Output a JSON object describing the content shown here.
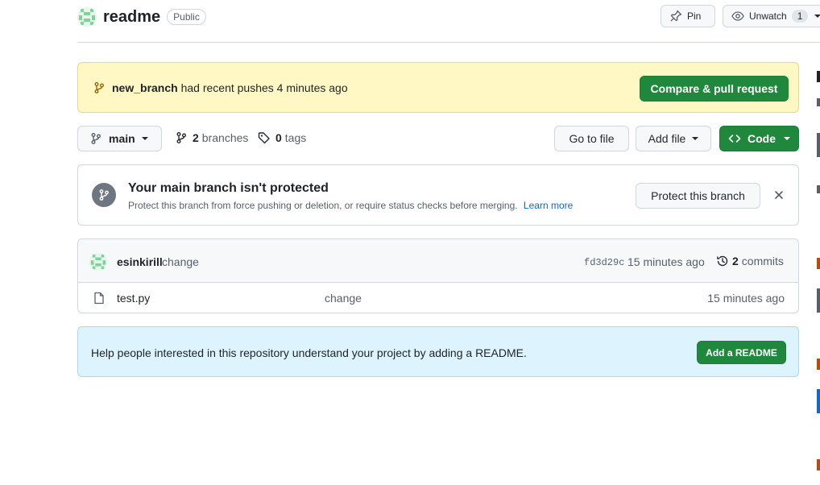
{
  "repo": {
    "name": "readme",
    "visibility": "Public"
  },
  "header_actions": {
    "pin_label": "Pin",
    "watch_label": "Unwatch",
    "watch_count": "1"
  },
  "push_banner": {
    "branch": "new_branch",
    "message": "had recent pushes 4 minutes ago",
    "button_label": "Compare & pull request"
  },
  "toolbar": {
    "branch": "main",
    "branches_count": "2",
    "branches_label": "branches",
    "tags_count": "0",
    "tags_label": "tags",
    "goto_file_label": "Go to file",
    "add_file_label": "Add file",
    "code_label": "Code"
  },
  "protection": {
    "title": "Your main branch isn't protected",
    "description": "Protect this branch from force pushing or deletion, or require status checks before merging.",
    "learn_more": "Learn more",
    "button_label": "Protect this branch"
  },
  "latest_commit": {
    "author": "esinkirill",
    "message": "change",
    "sha": "fd3d29c",
    "time": "15 minutes ago",
    "commits_count": "2",
    "commits_label": "commits"
  },
  "files": [
    {
      "name": "test.py",
      "message": "change",
      "time": "15 minutes ago"
    }
  ],
  "readme_prompt": {
    "text": "Help people interested in this repository understand your project by adding a README.",
    "button_label": "Add a README"
  },
  "colors": {
    "primary_green": "#1f883d",
    "banner_yellow": "#fff8c5",
    "readme_blue": "#ddf4ff",
    "link_blue": "#0969da"
  }
}
